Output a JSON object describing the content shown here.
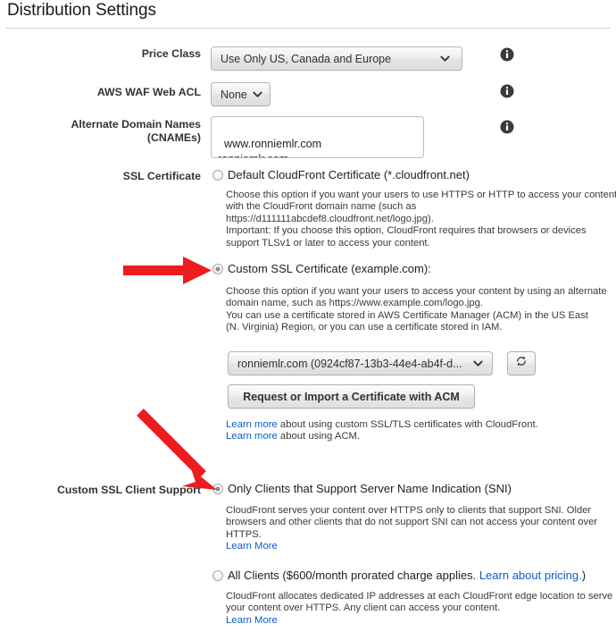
{
  "header": {
    "title": "Distribution Settings"
  },
  "colors": {
    "arrow": "#ee1c1c",
    "link": "#0b5ec7",
    "label": "#333333"
  },
  "fields": {
    "price_class": {
      "label": "Price Class",
      "selected": "Use Only US, Canada and Europe",
      "info_icon": "info-icon"
    },
    "waf_web_acl": {
      "label": "AWS WAF Web ACL",
      "selected": "None",
      "info_icon": "info-icon"
    },
    "cnames": {
      "label_line1": "Alternate Domain Names",
      "label_line2": "(CNAMEs)",
      "value": "www.ronniemlr.com\nronniemlr.com",
      "info_icon": "info-icon"
    },
    "ssl_certificate": {
      "label": "SSL Certificate",
      "options": [
        {
          "id": "default-cloudfront-certificate",
          "label": "Default CloudFront Certificate (*.cloudfront.net)",
          "checked": false,
          "help": [
            "Choose this option if you want your users to use HTTPS or HTTP to access your content",
            "with the CloudFront domain name (such as",
            "https://d111111abcdef8.cloudfront.net/logo.jpg).",
            "Important: If you choose this option, CloudFront requires that browsers or devices",
            "support TLSv1 or later to access your content."
          ]
        },
        {
          "id": "custom-ssl-certificate",
          "label": "Custom SSL Certificate (example.com):",
          "checked": true,
          "help": [
            "Choose this option if you want your users to access your content by using an alternate",
            "domain name, such as https://www.example.com/logo.jpg.",
            "You can use a certificate stored in AWS Certificate Manager (ACM) in the US East",
            "(N. Virginia) Region, or you can use a certificate stored in IAM."
          ]
        }
      ],
      "certificate_select": {
        "selected": "ronniemlr.com (0924cf87-13b3-44e4-ab4f-d...",
        "refresh_icon": "refresh-icon"
      },
      "acm_button": "Request or Import a Certificate with ACM",
      "links": [
        {
          "link_text": "Learn more",
          "rest_text": " about using custom SSL/TLS certificates with CloudFront."
        },
        {
          "link_text": "Learn more",
          "rest_text": " about using ACM."
        }
      ]
    },
    "client_support": {
      "label": "Custom SSL Client Support",
      "options": [
        {
          "id": "sni-only",
          "label_plain": "Only Clients that Support Server Name Indication (SNI)",
          "checked": true,
          "help": [
            "CloudFront serves your content over HTTPS only to clients that support SNI. Older",
            "browsers and other clients that do not support SNI can not access your content over",
            "HTTPS."
          ],
          "learn_more": "Learn More"
        },
        {
          "id": "all-clients",
          "label_pre": "All Clients ($600/month prorated charge applies. ",
          "label_link": "Learn about pricing.",
          "label_post": ")",
          "checked": false,
          "help": [
            "CloudFront allocates dedicated IP addresses at each CloudFront edge location to serve",
            "your content over HTTPS. Any client can access your content."
          ],
          "learn_more": "Learn More"
        }
      ]
    }
  },
  "annotations": [
    {
      "id": "arrow-to-custom-ssl",
      "type": "arrow-horizontal"
    },
    {
      "id": "arrow-to-sni-option",
      "type": "arrow-diagonal"
    }
  ]
}
